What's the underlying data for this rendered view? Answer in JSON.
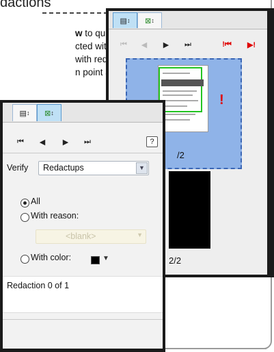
{
  "document": {
    "heading_fragment": "dactions",
    "body_lines": [
      {
        "bold": "w",
        "rest": " to quickly see"
      },
      {
        "bold": "",
        "rest": "cted within long"
      },
      {
        "bold": "",
        "rest": "with redactions"
      },
      {
        "bold": "",
        "rest": "n point and"
      }
    ],
    "trailing_dot": "."
  },
  "back_panel": {
    "tabs": [
      {
        "icon": "page-thumbnails-icon",
        "glyph": "▤",
        "suffix": "↕"
      },
      {
        "icon": "redaction-icon",
        "glyph": "⊠",
        "suffix": "↕"
      }
    ],
    "nav": [
      {
        "icon": "first-page-icon",
        "glyph": "⏮"
      },
      {
        "icon": "previous-page-icon",
        "glyph": "◀"
      },
      {
        "icon": "next-page-icon",
        "glyph": "▶"
      },
      {
        "icon": "last-page-icon",
        "glyph": "⏭"
      },
      {
        "icon": "first-flagged-icon",
        "glyph": "!⏮"
      },
      {
        "icon": "next-flagged-icon",
        "glyph": "▶!"
      }
    ],
    "flag_glyph": "!",
    "page_label_1": "/2",
    "page_label_2": "2/2"
  },
  "front_panel": {
    "tabs": [
      {
        "icon": "page-thumbnails-icon",
        "glyph": "▤",
        "suffix": "↕"
      },
      {
        "icon": "redaction-icon",
        "glyph": "⊠",
        "suffix": "↕"
      }
    ],
    "nav": [
      {
        "icon": "first-page-icon",
        "glyph": "⏮"
      },
      {
        "icon": "previous-page-icon",
        "glyph": "◀"
      },
      {
        "icon": "next-page-icon",
        "glyph": "▶"
      },
      {
        "icon": "last-page-icon",
        "glyph": "⏭"
      }
    ],
    "help_glyph": "?",
    "verify_label": "Verify",
    "verify_value": "Redactups",
    "options": {
      "all": "All",
      "with_reason": "With reason:",
      "reason_placeholder": "<blank>",
      "with_color": "With color:",
      "selected": "all"
    },
    "color_value": "#000000",
    "redaction_status": "Redaction 0 of 1"
  }
}
